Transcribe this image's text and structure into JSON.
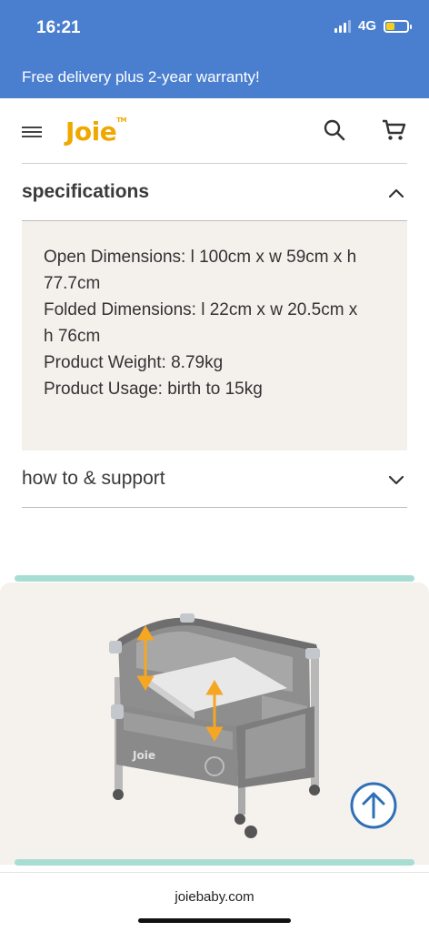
{
  "status_bar": {
    "time": "16:21",
    "network": "4G",
    "battery_color": "#f5d020"
  },
  "promo": {
    "text": "Free delivery plus 2-year warranty!"
  },
  "header": {
    "logo": "Joie",
    "logo_mark": "TM",
    "brand_color": "#f0a800",
    "icons": [
      "menu-icon",
      "search-icon",
      "cart-icon"
    ]
  },
  "accordion": {
    "specifications": {
      "title": "specifications",
      "expanded": true,
      "lines": [
        "Open Dimensions: l 100cm x w 59cm x h",
        "77.7cm",
        "Folded Dimensions: l 22cm x w 20.5cm x",
        "h 76cm",
        "Product Weight: 8.79kg",
        "Product Usage: birth to 15kg"
      ]
    },
    "support": {
      "title": "how to & support",
      "expanded": false
    }
  },
  "product_image": {
    "logo_text": "Joie"
  },
  "browser": {
    "url": "joiebaby.com"
  },
  "colors": {
    "header_blue": "#4a7fd0",
    "spec_bg": "#f4f1ed",
    "accent_mint": "#a8ddd4",
    "arrow_orange": "#f5a623"
  }
}
